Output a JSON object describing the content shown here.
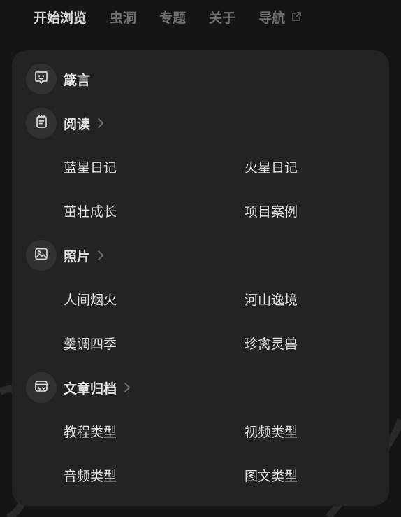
{
  "nav": {
    "items": [
      {
        "label": "开始浏览"
      },
      {
        "label": "虫洞"
      },
      {
        "label": "专题"
      },
      {
        "label": "关于"
      },
      {
        "label": "导航"
      }
    ]
  },
  "menu": {
    "groups": [
      {
        "label": "箴言",
        "icon": "quote-bubble-icon",
        "items": []
      },
      {
        "label": "阅读",
        "icon": "notebook-icon",
        "items": [
          "蓝星日记",
          "火星日记",
          "茁壮成长",
          "项目案例"
        ]
      },
      {
        "label": "照片",
        "icon": "image-icon",
        "items": [
          "人间烟火",
          "河山逸境",
          "羹调四季",
          "珍禽灵兽"
        ]
      },
      {
        "label": "文章归档",
        "icon": "archive-box-icon",
        "items": [
          "教程类型",
          "视频类型",
          "音频类型",
          "图文类型"
        ]
      }
    ]
  }
}
